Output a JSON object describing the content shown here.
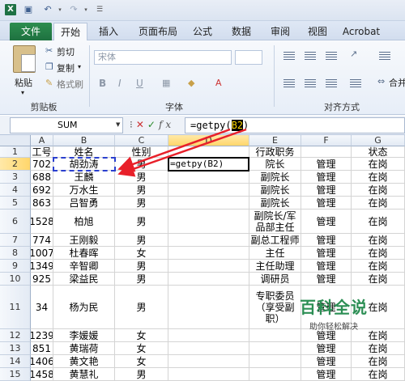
{
  "tabs": {
    "file": "文件",
    "home": "开始",
    "insert": "插入",
    "page_layout": "页面布局",
    "formulas": "公式",
    "data": "数据",
    "review": "审阅",
    "view": "视图",
    "acrobat": "Acrobat"
  },
  "ribbon": {
    "paste": "粘贴",
    "cut": "剪切",
    "copy": "复制",
    "copy_drop": "▾",
    "format_painter": "格式刷",
    "clipboard_group": "剪贴板",
    "font_name": "宋体",
    "font_group": "字体",
    "align_group": "对齐方式",
    "merge": "合并",
    "bold": "B",
    "italic": "I",
    "underline": "U"
  },
  "formula_bar": {
    "name_box": "SUM",
    "fx": "fx",
    "formula_prefix": "=getpy(",
    "formula_ref": "B2",
    "formula_suffix": ")"
  },
  "columns": [
    "A",
    "B",
    "C",
    "D",
    "E",
    "F",
    "G"
  ],
  "rows": [
    {
      "num": "1",
      "cells": [
        "工号",
        "姓名",
        "性别",
        "",
        "行政职务",
        "",
        "状态"
      ]
    },
    {
      "num": "2",
      "cells": [
        "702",
        "胡劲涛",
        "男",
        "=getpy(B2)",
        "院长",
        "管理",
        "在岗"
      ]
    },
    {
      "num": "3",
      "cells": [
        "688",
        "王麟",
        "男",
        "",
        "副院长",
        "管理",
        "在岗"
      ]
    },
    {
      "num": "4",
      "cells": [
        "692",
        "万水生",
        "男",
        "",
        "副院长",
        "管理",
        "在岗"
      ]
    },
    {
      "num": "5",
      "cells": [
        "863",
        "吕智勇",
        "男",
        "",
        "副院长",
        "管理",
        "在岗"
      ]
    },
    {
      "num": "6",
      "cells": [
        "1528",
        "柏旭",
        "男",
        "",
        "副院长/军品部主任",
        "管理",
        "在岗"
      ]
    },
    {
      "num": "7",
      "cells": [
        "774",
        "王刚毅",
        "男",
        "",
        "副总工程师",
        "管理",
        "在岗"
      ]
    },
    {
      "num": "8",
      "cells": [
        "1007",
        "杜春晖",
        "女",
        "",
        "主任",
        "管理",
        "在岗"
      ]
    },
    {
      "num": "9",
      "cells": [
        "1349",
        "辛智卿",
        "男",
        "",
        "主任助理",
        "管理",
        "在岗"
      ]
    },
    {
      "num": "10",
      "cells": [
        "925",
        "梁益民",
        "男",
        "",
        "调研员",
        "管理",
        "在岗"
      ]
    },
    {
      "num": "11",
      "cells": [
        "34",
        "杨为民",
        "男",
        "",
        "专职委员（享受副职）",
        "管理",
        "在岗"
      ]
    },
    {
      "num": "12",
      "cells": [
        "1239",
        "李媛媛",
        "女",
        "",
        "",
        "管理",
        "在岗"
      ]
    },
    {
      "num": "13",
      "cells": [
        "851",
        "黄瑞荷",
        "女",
        "",
        "",
        "管理",
        "在岗"
      ]
    },
    {
      "num": "14",
      "cells": [
        "1406",
        "黄文艳",
        "女",
        "",
        "",
        "管理",
        "在岗"
      ]
    },
    {
      "num": "15",
      "cells": [
        "1458",
        "黄慧礼",
        "男",
        "",
        "",
        "管理",
        "在岗"
      ]
    }
  ],
  "watermark": {
    "title": "百科全说",
    "subtitle": "助你轻松解决"
  },
  "colors": {
    "file_tab": "#1e7140",
    "arrow": "#e8202a",
    "selection_dash": "#2a3fcf",
    "highlight_ref": "#ffd800"
  }
}
